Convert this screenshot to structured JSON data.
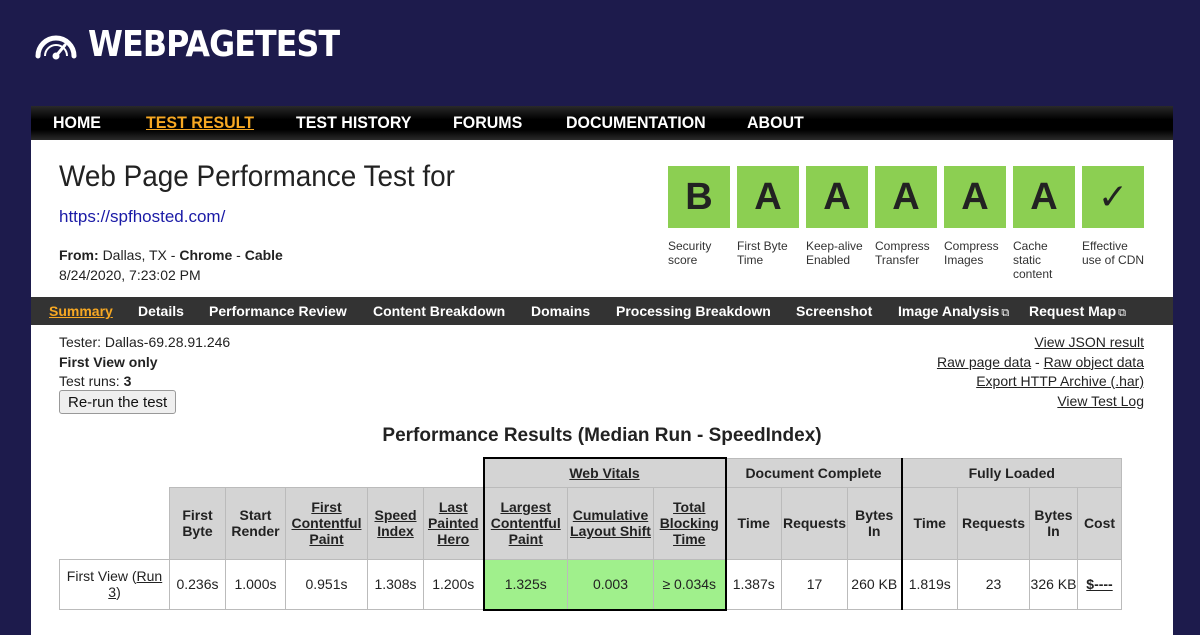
{
  "logo": {
    "text": "WEBPAGETEST",
    "icon": "speedometer-icon"
  },
  "topnav": [
    {
      "label": "HOME",
      "active": false
    },
    {
      "label": "TEST RESULT",
      "active": true
    },
    {
      "label": "TEST HISTORY",
      "active": false
    },
    {
      "label": "FORUMS",
      "active": false
    },
    {
      "label": "DOCUMENTATION",
      "active": false
    },
    {
      "label": "ABOUT",
      "active": false
    }
  ],
  "header": {
    "title": "Web Page Performance Test for",
    "url": "https://spfhosted.com/",
    "from_label": "From:",
    "location": "Dallas, TX",
    "browser": "Chrome",
    "connection": "Cable",
    "date": "8/24/2020, 7:23:02 PM"
  },
  "grades": [
    {
      "grade": "B",
      "label": "Security score"
    },
    {
      "grade": "A",
      "label": "First Byte Time"
    },
    {
      "grade": "A",
      "label": "Keep-alive Enabled"
    },
    {
      "grade": "A",
      "label": "Compress Transfer"
    },
    {
      "grade": "A",
      "label": "Compress Images"
    },
    {
      "grade": "A",
      "label": "Cache static content"
    },
    {
      "grade": "✓",
      "label": "Effective use of CDN"
    }
  ],
  "grade_color": "#8ccf52",
  "subnav": [
    {
      "label": "Summary",
      "active": true,
      "external": false
    },
    {
      "label": "Details",
      "active": false,
      "external": false
    },
    {
      "label": "Performance Review",
      "active": false,
      "external": false
    },
    {
      "label": "Content Breakdown",
      "active": false,
      "external": false
    },
    {
      "label": "Domains",
      "active": false,
      "external": false
    },
    {
      "label": "Processing Breakdown",
      "active": false,
      "external": false
    },
    {
      "label": "Screenshot",
      "active": false,
      "external": false
    },
    {
      "label": "Image Analysis",
      "active": false,
      "external": true
    },
    {
      "label": "Request Map",
      "active": false,
      "external": true
    }
  ],
  "test_info": {
    "tester": "Tester: Dallas-69.28.91.246",
    "view": "First View only",
    "runs_label": "Test runs:",
    "runs": "3",
    "rerun_button": "Re-run the test"
  },
  "links": {
    "json": "View JSON result",
    "raw_page": "Raw page data",
    "sep": "-",
    "raw_object": "Raw object data",
    "har": "Export HTTP Archive (.har)",
    "log": "View Test Log"
  },
  "results": {
    "title": "Performance Results (Median Run - SpeedIndex)",
    "groups": {
      "web_vitals": "Web Vitals",
      "document_complete": "Document Complete",
      "fully_loaded": "Fully Loaded"
    },
    "columns": {
      "first_byte": "First Byte",
      "start_render": "Start Render",
      "fcp": "First Contentful Paint",
      "speed_index": "Speed Index",
      "lph": "Last Painted Hero",
      "lcp": "Largest Contentful Paint",
      "cls": "Cumulative Layout Shift",
      "tbt": "Total Blocking Time",
      "doc_time": "Time",
      "doc_requests": "Requests",
      "doc_bytes": "Bytes In",
      "full_time": "Time",
      "full_requests": "Requests",
      "full_bytes": "Bytes In",
      "cost": "Cost"
    },
    "row": {
      "label": "First View (",
      "run_link": "Run 3",
      "label_end": ")",
      "first_byte": "0.236s",
      "start_render": "1.000s",
      "fcp": "0.951s",
      "speed_index": "1.308s",
      "lph": "1.200s",
      "lcp": "1.325s",
      "cls": "0.003",
      "tbt": "≥ 0.034s",
      "doc_time": "1.387s",
      "doc_requests": "17",
      "doc_bytes": "260 KB",
      "full_time": "1.819s",
      "full_requests": "23",
      "full_bytes": "326 KB",
      "cost": "$----"
    }
  }
}
